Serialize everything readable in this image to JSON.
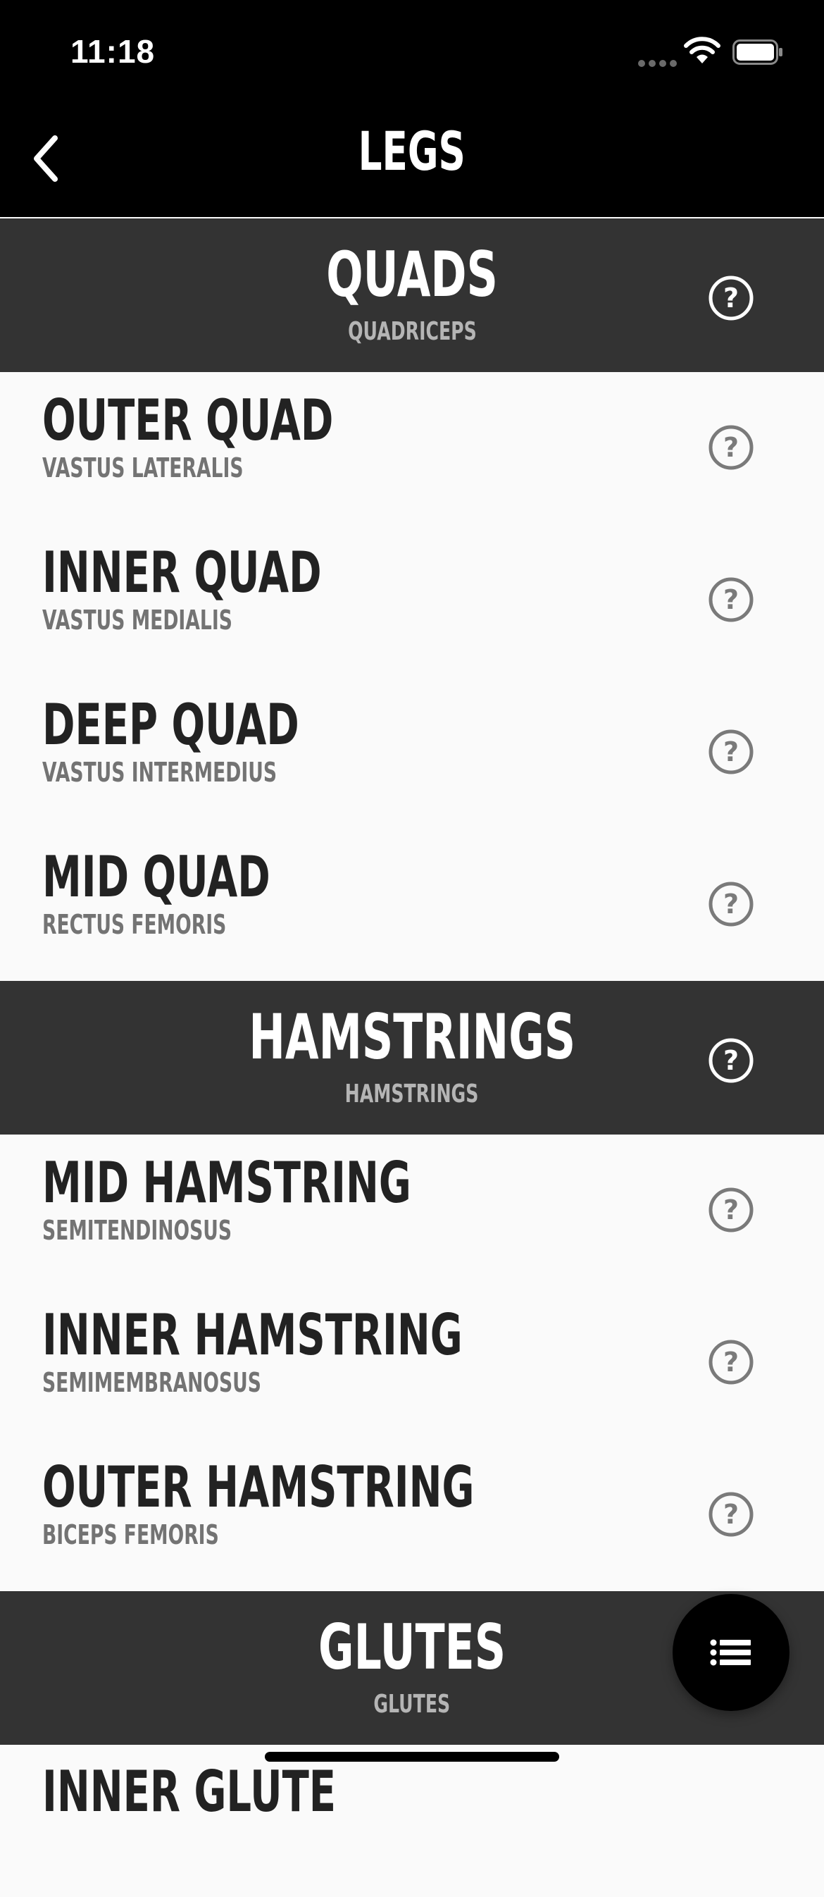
{
  "status_bar": {
    "time": "11:18"
  },
  "nav": {
    "title": "LEGS",
    "back_icon": "chevron-left-icon"
  },
  "sections": [
    {
      "title": "QUADS",
      "subtitle": "QUADRICEPS",
      "items": [
        {
          "title": "OUTER QUAD",
          "subtitle": "VASTUS LATERALIS"
        },
        {
          "title": "INNER QUAD",
          "subtitle": "VASTUS MEDIALIS"
        },
        {
          "title": "DEEP QUAD",
          "subtitle": "VASTUS INTERMEDIUS"
        },
        {
          "title": "MID QUAD",
          "subtitle": "RECTUS FEMORIS"
        }
      ]
    },
    {
      "title": "HAMSTRINGS",
      "subtitle": "HAMSTRINGS",
      "items": [
        {
          "title": "MID HAMSTRING",
          "subtitle": "SEMITENDINOSUS"
        },
        {
          "title": "INNER HAMSTRING",
          "subtitle": "SEMIMEMBRANOSUS"
        },
        {
          "title": "OUTER HAMSTRING",
          "subtitle": "BICEPS FEMORIS"
        }
      ]
    },
    {
      "title": "GLUTES",
      "subtitle": "GLUTES",
      "items": [
        {
          "title": "INNER GLUTE",
          "subtitle": ""
        }
      ]
    }
  ],
  "fab_icon": "list-icon",
  "colors": {
    "header_bg": "#333333",
    "row_bg": "#fafafa",
    "nav_bg": "#000000"
  }
}
